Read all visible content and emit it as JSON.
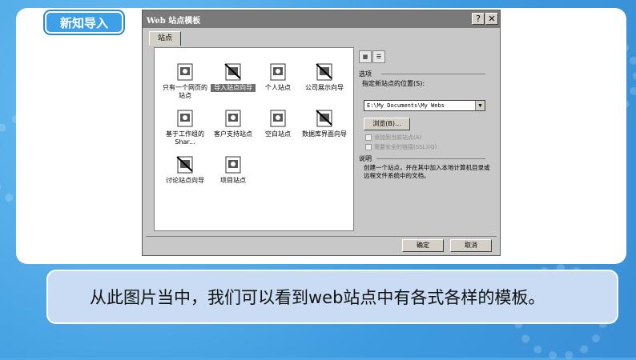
{
  "slide": {
    "tag": "新知导入",
    "caption": "从此图片当中，我们可以看到web站点中有各式各样的模板。"
  },
  "dialog": {
    "title": "Web 站点模板",
    "help_button": "?",
    "close_button": "✕",
    "tab_label": "站点",
    "items": [
      {
        "label": "只有一个网页的站点"
      },
      {
        "label": "导入站点向导"
      },
      {
        "label": "个人站点"
      },
      {
        "label": "公司展示向导"
      },
      {
        "label": "基于工作组的 Shar..."
      },
      {
        "label": "客户支持站点"
      },
      {
        "label": "空白站点"
      },
      {
        "label": "数据库界面向导"
      },
      {
        "label": "讨论站点向导"
      },
      {
        "label": "项目站点"
      }
    ],
    "options_title": "选项",
    "location_label": "指定新站点的位置(S):",
    "location_value": "E:\\My Documents\\My Webs",
    "browse_button": "浏览(B)...",
    "check_add": "添加到当前站点(A)",
    "check_ssl": "需要安全的链接(SSL)(Q)",
    "desc_title": "说明",
    "desc_text": "创建一个站点，并在其中加入本地计算机目录或远程文件系统中的文档。",
    "ok_button": "确定",
    "cancel_button": "取消"
  },
  "colors": {
    "slide_bg": "#4fa8e6",
    "tag_bg": "#3ea0e6",
    "caption_bg": "#c9dcf3"
  }
}
